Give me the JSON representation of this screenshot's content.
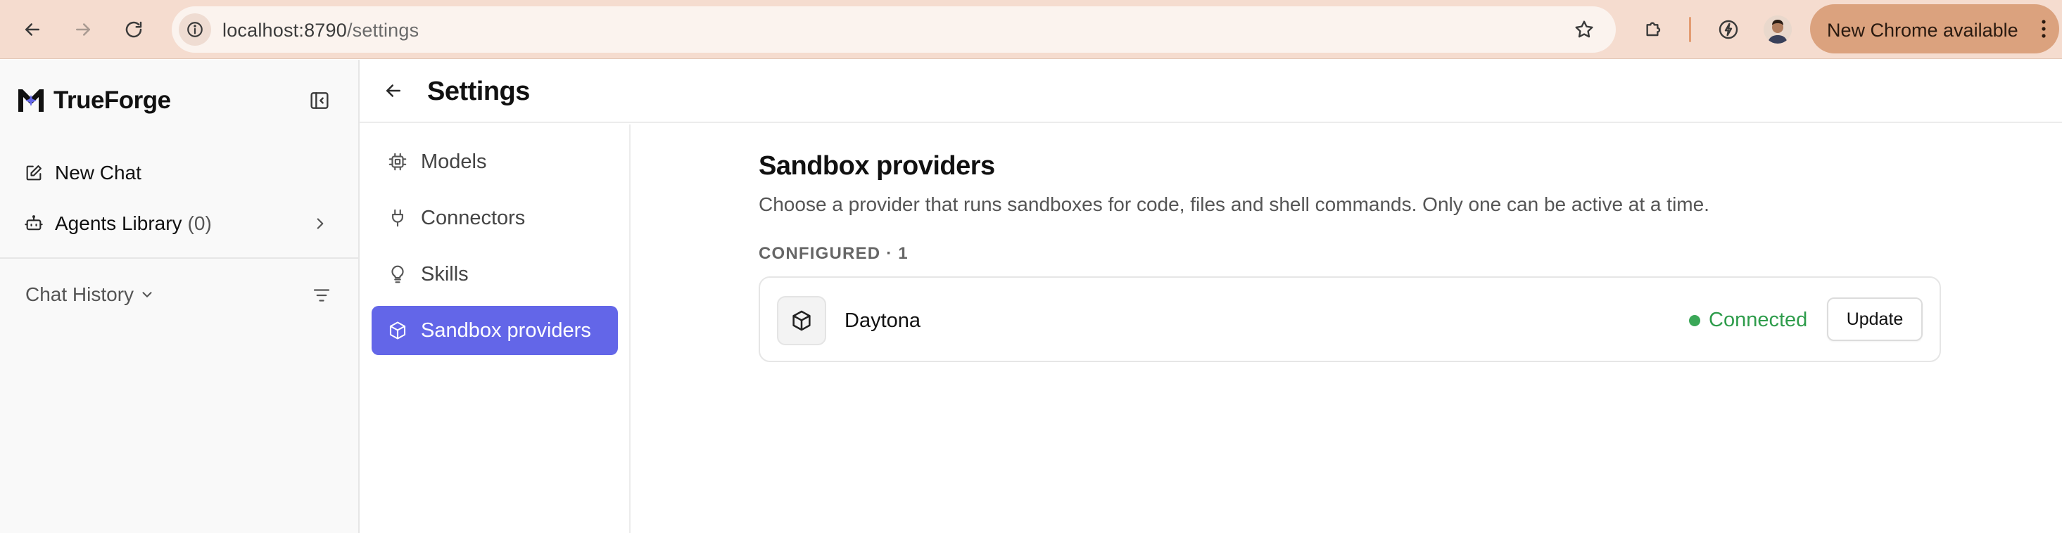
{
  "browser": {
    "url_host": "localhost:8790",
    "url_path": "/settings",
    "update_label": "New Chrome available",
    "accent_color": "#dba27e"
  },
  "sidebar": {
    "brand": "TrueForge",
    "new_chat": "New Chat",
    "agents_library": "Agents Library",
    "agents_count": "(0)",
    "chat_history": "Chat History"
  },
  "header": {
    "title": "Settings"
  },
  "settings_nav": {
    "items": [
      {
        "label": "Models",
        "icon": "cpu-icon"
      },
      {
        "label": "Connectors",
        "icon": "plug-icon"
      },
      {
        "label": "Skills",
        "icon": "lightbulb-icon"
      },
      {
        "label": "Sandbox providers",
        "icon": "box-icon",
        "active": true
      }
    ],
    "active_color": "#6366e8"
  },
  "content": {
    "title": "Sandbox providers",
    "description": "Choose a provider that runs sandboxes for code, files and shell commands. Only one can be active at a time.",
    "configured_label": "CONFIGURED · 1",
    "providers": [
      {
        "name": "Daytona",
        "icon": "box-icon",
        "status": "Connected",
        "status_color": "#3aa757",
        "action": "Update"
      }
    ]
  }
}
